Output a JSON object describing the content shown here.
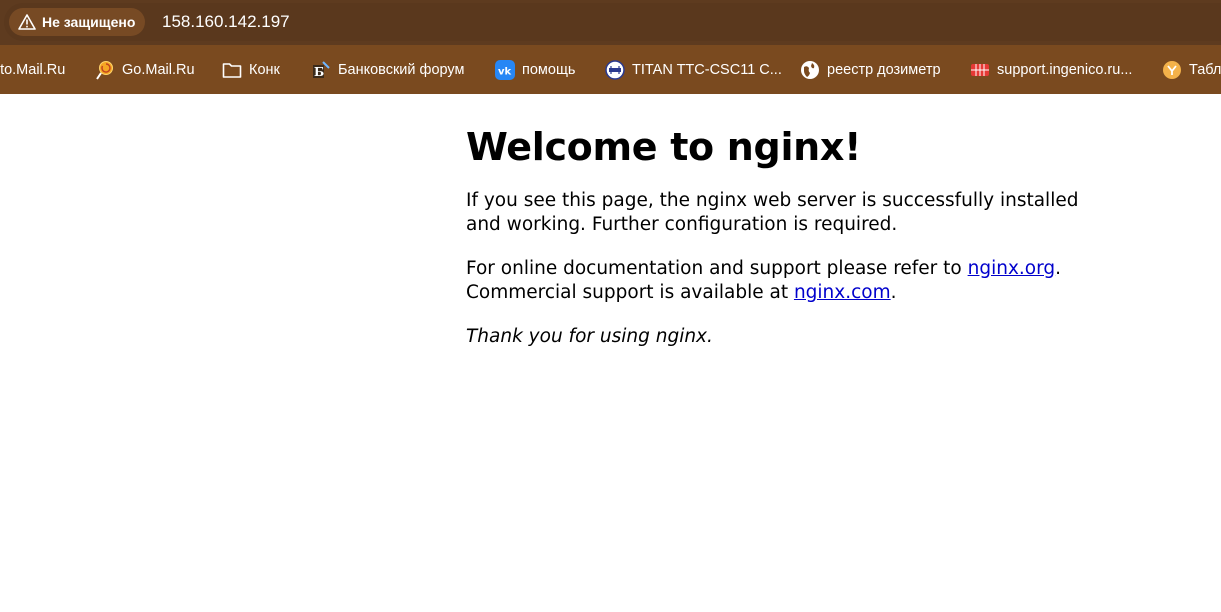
{
  "browser": {
    "security_label": "Не защищено",
    "url": "158.160.142.197",
    "bookmarks": [
      {
        "label": "oto.Mail.Ru",
        "icon": "mail-photo-icon"
      },
      {
        "label": "Go.Mail.Ru",
        "icon": "lollipop-icon"
      },
      {
        "label": "Конк",
        "icon": "folder-icon"
      },
      {
        "label": "Банковский форум",
        "icon": "bank-forum-icon"
      },
      {
        "label": "помощь",
        "icon": "vk-icon"
      },
      {
        "label": "TITAN TTC-CSC11 C...",
        "icon": "titan-icon"
      },
      {
        "label": "реестр дозиметр",
        "icon": "globe-icon"
      },
      {
        "label": "support.ingenico.ru...",
        "icon": "ingenico-icon"
      },
      {
        "label": "Табл",
        "icon": "sheets-icon"
      }
    ]
  },
  "page": {
    "heading": "Welcome to nginx!",
    "para1": "If you see this page, the nginx web server is successfully installed and working. Further configuration is required.",
    "para2_prefix": "For online documentation and support please refer to ",
    "para2_link1": "nginx.org",
    "para2_mid": ".",
    "para2_line2_prefix": "Commercial support is available at ",
    "para2_link2": "nginx.com",
    "para2_suffix": ".",
    "para3": "Thank you for using nginx."
  },
  "colors": {
    "toolbar": "#7a4a1f",
    "addressbar": "#5e3b1f",
    "link": "#0000cc"
  }
}
